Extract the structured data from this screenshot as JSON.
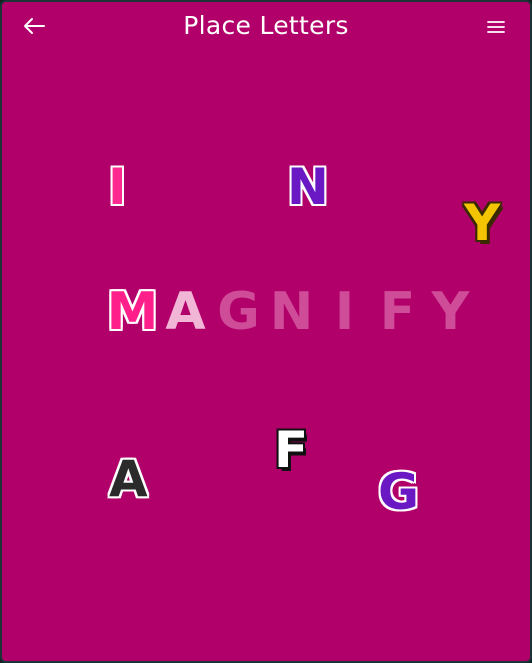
{
  "header": {
    "title": "Place Letters",
    "back_icon": "arrow-left-icon",
    "menu_icon": "hamburger-menu-icon"
  },
  "target_word": {
    "letters": [
      "M",
      "A",
      "G",
      "N",
      "I",
      "F",
      "Y"
    ],
    "states": [
      "placed",
      "placed",
      "hint",
      "hint",
      "hint",
      "hint",
      "hint"
    ]
  },
  "loose_letters": [
    {
      "letter": "I",
      "color": "#ff2a8f"
    },
    {
      "letter": "N",
      "color": "#6a17c4"
    },
    {
      "letter": "Y",
      "color": "#f2c500"
    },
    {
      "letter": "A",
      "color": "#2b2b2b"
    },
    {
      "letter": "F",
      "color": "#ffffff"
    },
    {
      "letter": "G",
      "color": "#6a17c4"
    }
  ],
  "colors": {
    "background": "#b2006a",
    "text": "#ffffff"
  }
}
